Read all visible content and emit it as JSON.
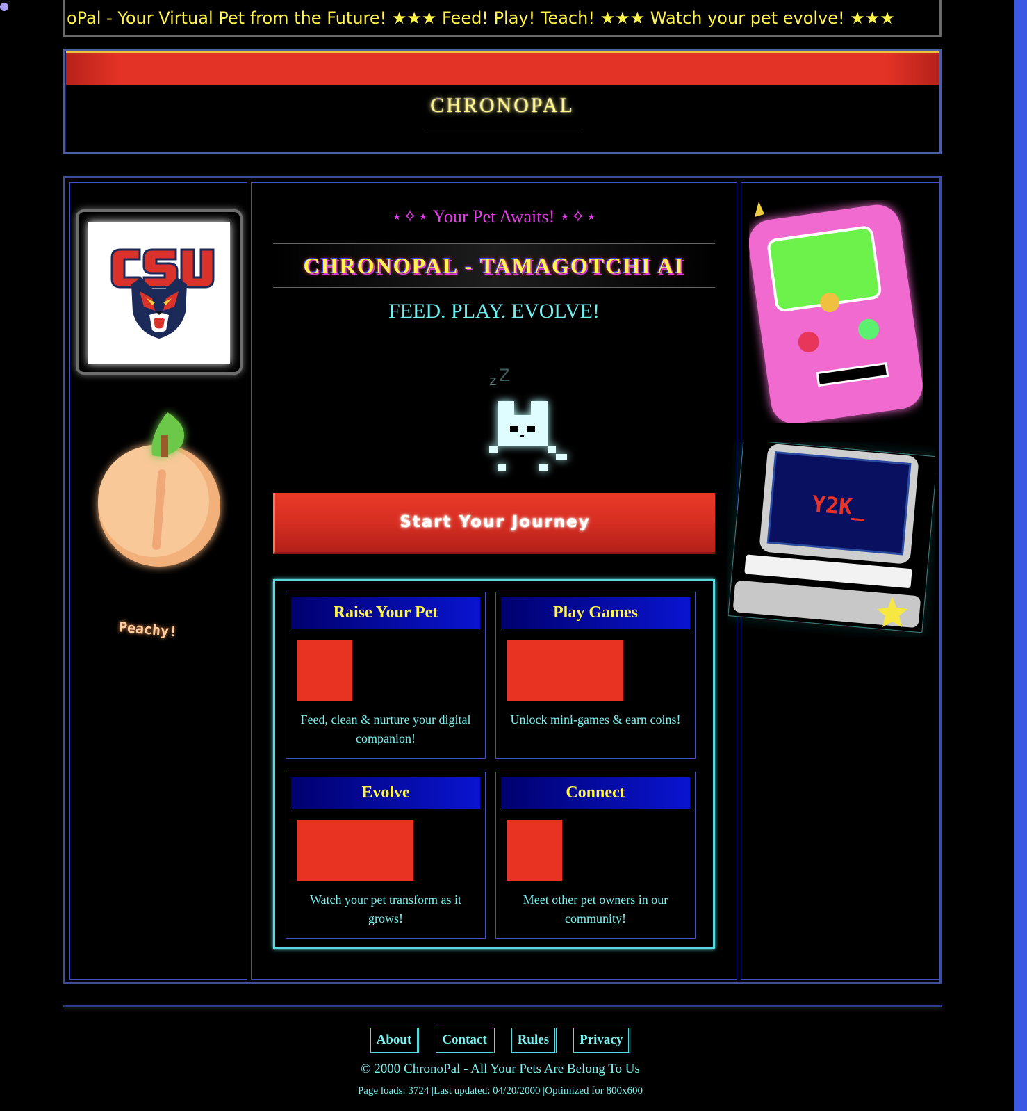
{
  "marquee": {
    "text": "oPal - Your Virtual Pet from the Future! ★★★ Feed! Play! Teach! ★★★ Watch your pet evolve! ★★★"
  },
  "header": {
    "title": "CHRONOPAL"
  },
  "left": {
    "peach_label": "Peachy!"
  },
  "center": {
    "awaits": "⋆✧⋆ Your Pet Awaits! ⋆✧⋆",
    "headline": "CHRONOPAL - TAMAGOTCHI AI",
    "tagline": "FEED. PLAY. EVOLVE!",
    "pet_sleep": [
      "z",
      "Z"
    ],
    "start_button": "Start Your Journey",
    "features": [
      {
        "title": "Raise Your Pet",
        "text": "Feed, clean & nurture your digital companion!"
      },
      {
        "title": "Play Games",
        "text": "Unlock mini-games & earn coins!"
      },
      {
        "title": "Evolve",
        "text": "Watch your pet transform as it grows!"
      },
      {
        "title": "Connect",
        "text": "Meet other pet owners in our community!"
      }
    ]
  },
  "right": {
    "computer_screen_text": "Y2K_"
  },
  "footer": {
    "nav": [
      "About",
      "Contact",
      "Rules",
      "Privacy"
    ],
    "copyright": "© 2000 ChronoPal - All Your Pets Are Belong To Us",
    "stats": "Page loads: 3724 |Last updated: 04/20/2000 |Optimized for 800x600"
  },
  "colors": {
    "background": "#000000",
    "accent_yellow": "#fff34c",
    "accent_cyan": "#7ff0f0",
    "accent_magenta": "#e43ce8",
    "accent_red": "#e83323",
    "frame_blue": "#3f52c0"
  }
}
